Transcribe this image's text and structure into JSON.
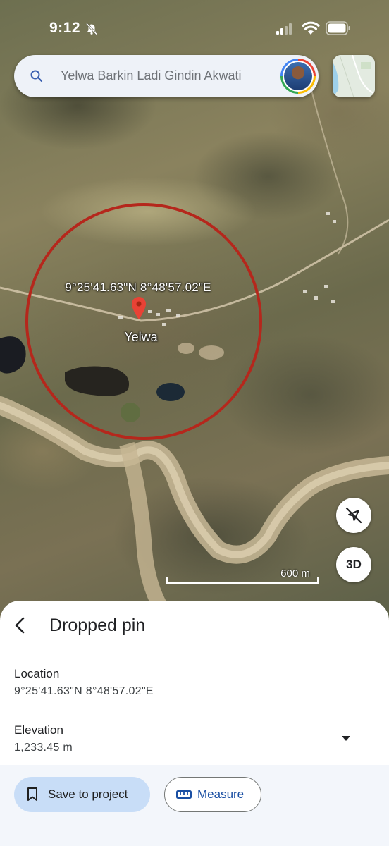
{
  "status_bar": {
    "time": "9:12"
  },
  "search": {
    "query": "Yelwa Barkin Ladi Gindin Akwati"
  },
  "map": {
    "pin_coordinates": "9°25'41.63\"N 8°48'57.02\"E",
    "place_name": "Yelwa",
    "scale_label": "600 m",
    "btn_3d": "3D",
    "accent_circle_color": "#b5271c"
  },
  "sheet": {
    "title": "Dropped pin",
    "location_label": "Location",
    "location_value": "9°25'41.63\"N 8°48'57.02\"E",
    "elevation_label": "Elevation",
    "elevation_value": "1,233.45 m",
    "save_label": "Save to project",
    "measure_label": "Measure"
  }
}
